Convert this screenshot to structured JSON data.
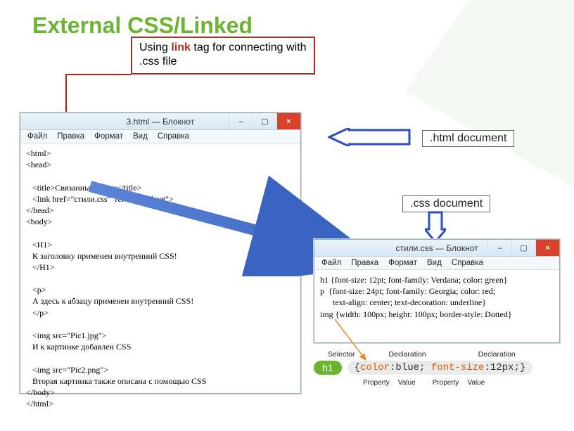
{
  "title": "External CSS/Linked",
  "info_box": {
    "pre": "Using ",
    "accent": "link",
    "post": " tag for connecting with .css file"
  },
  "notepad_html": {
    "window_title": "3.html — Блокнот",
    "menu": [
      "Файл",
      "Правка",
      "Формат",
      "Вид",
      "Справка"
    ],
    "code": "<html>\n<head>\n\n   <title>Связанные стили</title>\n   <link href=\"стили.css\"  rel=\"stylesheet\">\n</head>\n<body>\n\n   <H1>\n   К заголовку применен внутренний CSS!\n   </H1>\n\n   <p>\n   А здесь к абзацу применен внутренний CSS!\n   </p>\n\n   <img src=\"Pic1.jpg\">\n   И к картинке добавлен CSS\n\n   <img src=\"Pic2.png\">\n   Вторая картинка также описана с помощью CSS\n</body>\n</html>"
  },
  "notepad_css": {
    "window_title": "стили.css — Блокнот",
    "menu": [
      "Файл",
      "Правка",
      "Формат",
      "Вид",
      "Справка"
    ],
    "code": "h1 {font-size: 12pt; font-family: Verdana; color: green}\np  {font-size: 24pt; font-family: Georgia; color: red;\n      text-align: center; text-decoration: underline}\nimg {width: 100px; height: 100px; border-style: Dotted}"
  },
  "labels": {
    "html": ".html document",
    "css": ".css document"
  },
  "syntax": {
    "top": [
      "Selector",
      "Declaration",
      "Declaration"
    ],
    "selector": "h1",
    "decl_text": "{color:blue; font-size:12px;}",
    "bottom": [
      "Property",
      "Value",
      "Property",
      "Value"
    ]
  },
  "window_controls": {
    "min": "–",
    "max": "▢",
    "close": "×"
  }
}
